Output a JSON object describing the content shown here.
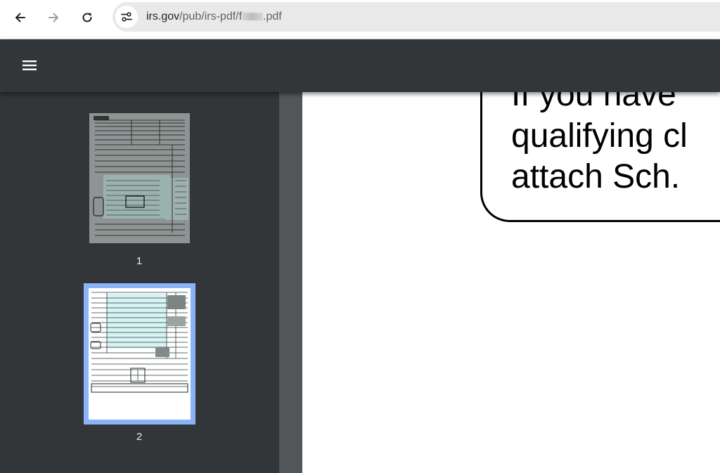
{
  "browser": {
    "url_host": "irs.gov",
    "url_path_prefix": "/pub/irs-pdf/f",
    "url_path_suffix": ".pdf",
    "icons": {
      "back": "arrow-left-icon",
      "forward": "arrow-right-icon",
      "reload": "reload-icon",
      "site_info": "tune-icon"
    }
  },
  "viewer": {
    "menu_icon": "hamburger-menu-icon",
    "thumbnails": [
      {
        "label": "1",
        "selected": false
      },
      {
        "label": "2",
        "selected": true
      }
    ],
    "page_text": {
      "line1": "If you have",
      "line2": "qualifying cl",
      "line3": "attach Sch."
    },
    "colors": {
      "toolbar": "#323639",
      "gutter": "#525659",
      "selection": "#8ab4f8"
    }
  }
}
